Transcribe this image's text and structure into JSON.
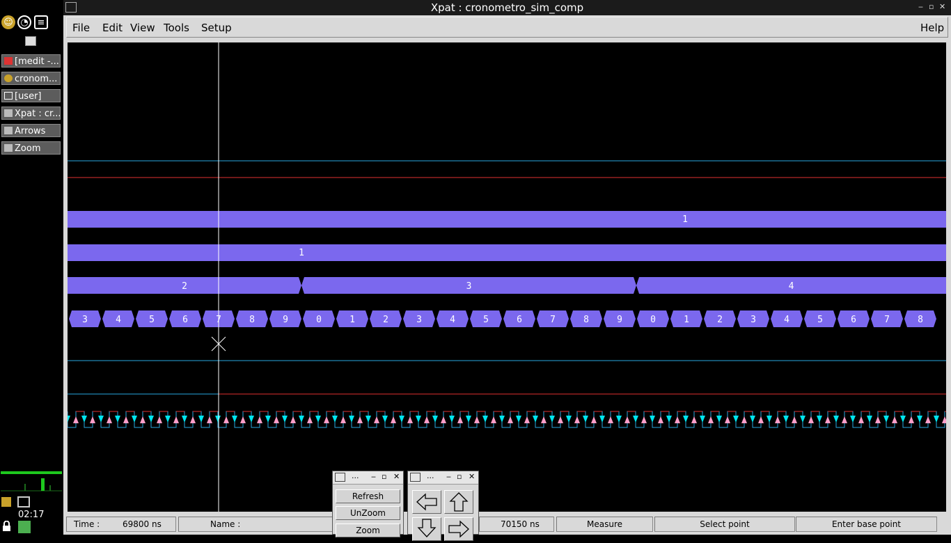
{
  "taskbar": {
    "tasks": [
      {
        "label": "[medit -..."
      },
      {
        "label": "cronom..."
      },
      {
        "label": "[user]"
      },
      {
        "label": "Xpat : cr..."
      },
      {
        "label": "Arrows"
      },
      {
        "label": "Zoom"
      }
    ],
    "clock": "02:17"
  },
  "window": {
    "title": "Xpat : cronometro_sim_comp",
    "menu": {
      "file": "File",
      "edit": "Edit",
      "view": "View",
      "tools": "Tools",
      "setup": "Setup",
      "help": "Help"
    }
  },
  "waveform": {
    "cursor_time_ns": 69800,
    "colors": {
      "bus": "#7b68ee",
      "high": "#e03030",
      "low": "#29a8e0",
      "cursor": "#ffffff",
      "bg": "#000000",
      "rise_marker": "#ff9ec8",
      "fall_marker": "#00e5ee"
    },
    "signal1": {
      "value": "1"
    },
    "signal2": {
      "value": "1"
    },
    "signal3": {
      "values": [
        "2",
        "3",
        "4"
      ]
    },
    "signal4": {
      "values": [
        "3",
        "4",
        "5",
        "6",
        "7",
        "8",
        "9",
        "0",
        "1",
        "2",
        "3",
        "4",
        "5",
        "6",
        "7",
        "8",
        "9",
        "0",
        "1",
        "2",
        "3",
        "4",
        "5",
        "6",
        "7",
        "8"
      ]
    }
  },
  "status": {
    "time_label": "Time :",
    "time_value": "69800 ns",
    "name_label": "Name :",
    "time2_value": "70150 ns",
    "measure": "Measure",
    "select_point": "Select point",
    "enter_base_point": "Enter base point"
  },
  "zoom_popup": {
    "title": "...",
    "refresh": "Refresh",
    "unzoom": "UnZoom",
    "zoom": "Zoom"
  },
  "arrows_popup": {
    "title": "..."
  }
}
